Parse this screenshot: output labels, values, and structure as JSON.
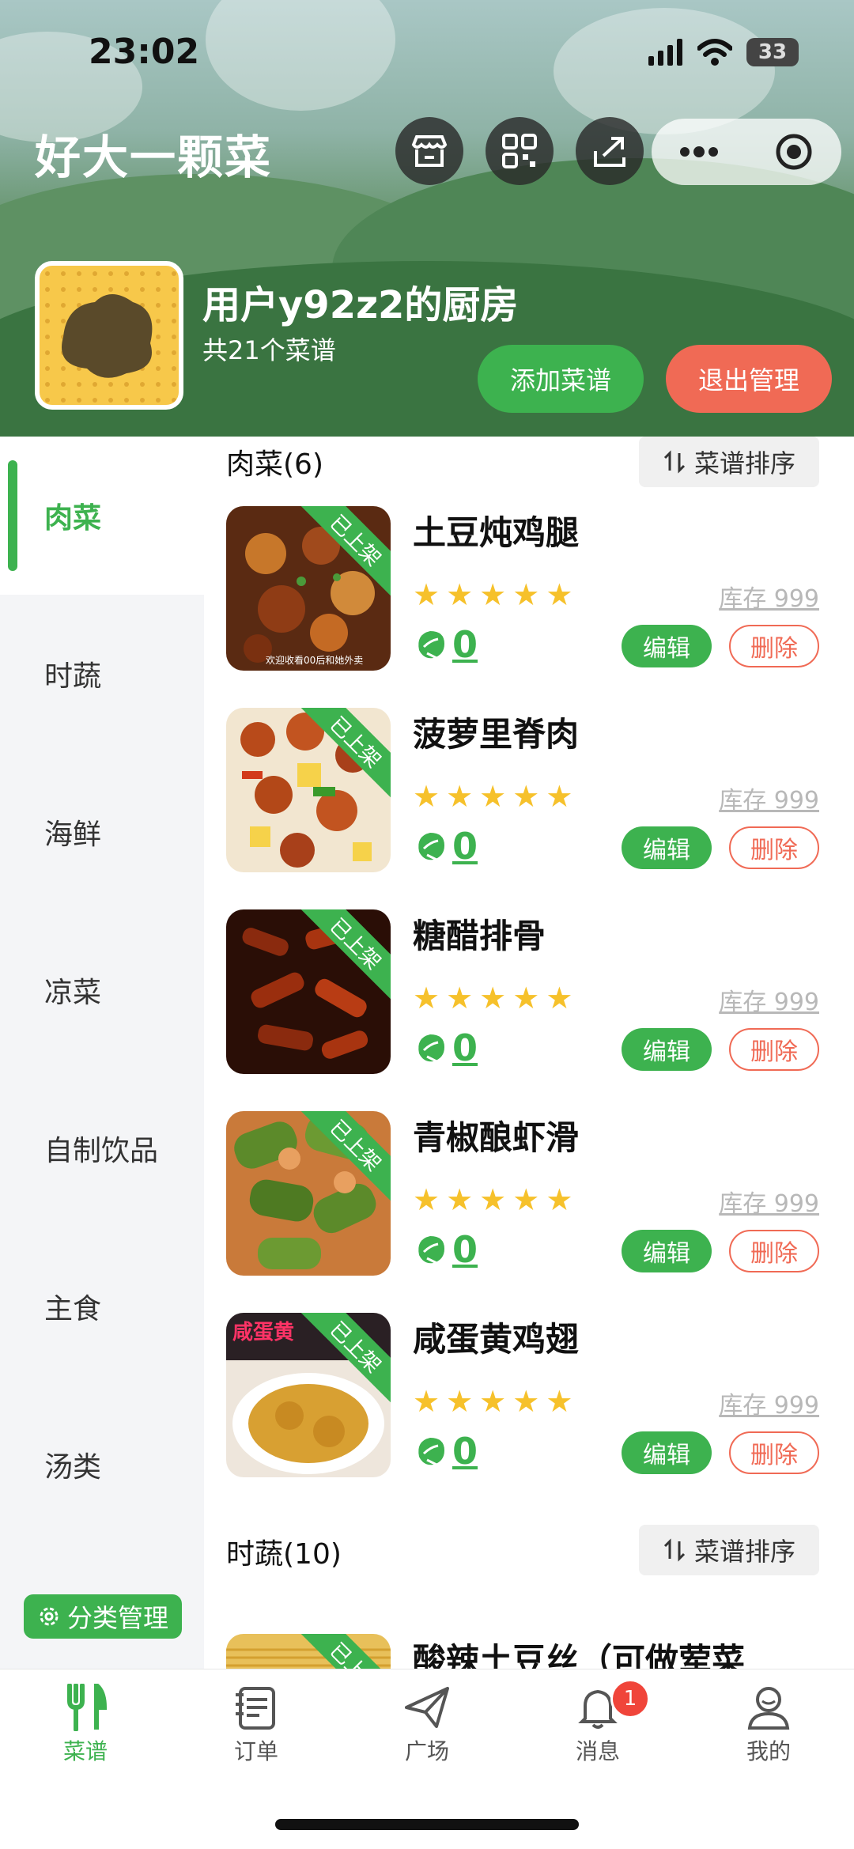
{
  "status": {
    "time": "23:02",
    "battery": "33"
  },
  "header": {
    "app_title": "好大一颗菜",
    "kitchen_title": "用户y92z2的厨房",
    "recipe_count": "共21个菜谱",
    "add_label": "添加菜谱",
    "exit_label": "退出管理"
  },
  "sidebar": {
    "items": [
      {
        "label": "肉菜",
        "active": true
      },
      {
        "label": "时蔬"
      },
      {
        "label": "海鲜"
      },
      {
        "label": "凉菜"
      },
      {
        "label": "自制饮品"
      },
      {
        "label": "主食"
      },
      {
        "label": "汤类"
      }
    ],
    "manage_label": "分类管理"
  },
  "sections": [
    {
      "title": "肉菜(6)",
      "sort_label": "菜谱排序"
    },
    {
      "title": "时蔬(10)",
      "sort_label": "菜谱排序"
    }
  ],
  "dishes": [
    {
      "name": "土豆炖鸡腿",
      "status": "已上架",
      "stock": "库存 999",
      "count": "0",
      "rating": 5,
      "edit": "编辑",
      "delete": "删除",
      "thumb_caption": "欢迎收看00后和她外卖"
    },
    {
      "name": "菠萝里脊肉",
      "status": "已上架",
      "stock": "库存 999",
      "count": "0",
      "rating": 5,
      "edit": "编辑",
      "delete": "删除"
    },
    {
      "name": "糖醋排骨",
      "status": "已上架",
      "stock": "库存 999",
      "count": "0",
      "rating": 5,
      "edit": "编辑",
      "delete": "删除"
    },
    {
      "name": "青椒酿虾滑",
      "status": "已上架",
      "stock": "库存 999",
      "count": "0",
      "rating": 5,
      "edit": "编辑",
      "delete": "删除"
    },
    {
      "name": "咸蛋黄鸡翅",
      "status": "已上架",
      "stock": "库存 999",
      "count": "0",
      "rating": 5,
      "edit": "编辑",
      "delete": "删除",
      "thumb_caption": "咸蛋黄"
    },
    {
      "name": "酸辣土豆丝（可做荤菜",
      "status": "已上架"
    }
  ],
  "tabbar": {
    "items": [
      {
        "label": "菜谱",
        "icon": "fork-knife-icon",
        "active": true
      },
      {
        "label": "订单",
        "icon": "order-icon"
      },
      {
        "label": "广场",
        "icon": "paper-plane-icon"
      },
      {
        "label": "消息",
        "icon": "bell-icon",
        "badge": "1"
      },
      {
        "label": "我的",
        "icon": "user-icon"
      }
    ]
  },
  "colors": {
    "accent": "#3db24f",
    "danger": "#f06a55",
    "star": "#f6c12b"
  }
}
